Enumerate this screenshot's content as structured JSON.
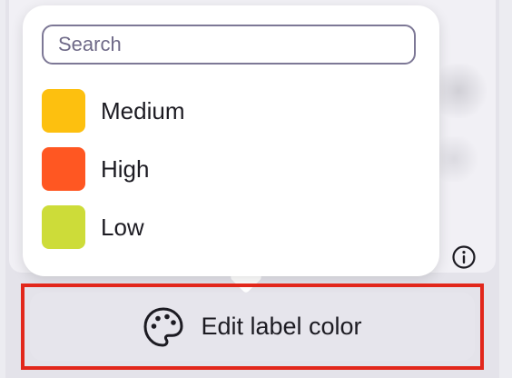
{
  "search": {
    "placeholder": "Search",
    "value": ""
  },
  "options": [
    {
      "label": "Medium",
      "color": "#fdc00f"
    },
    {
      "label": "High",
      "color": "#ff5722"
    },
    {
      "label": "Low",
      "color": "#cddc39"
    }
  ],
  "edit_button": {
    "label": "Edit label color",
    "icon": "palette-icon"
  },
  "info": {
    "icon": "info-icon"
  },
  "colors": {
    "highlight_border": "#e2271b",
    "search_border": "#7d7896"
  }
}
